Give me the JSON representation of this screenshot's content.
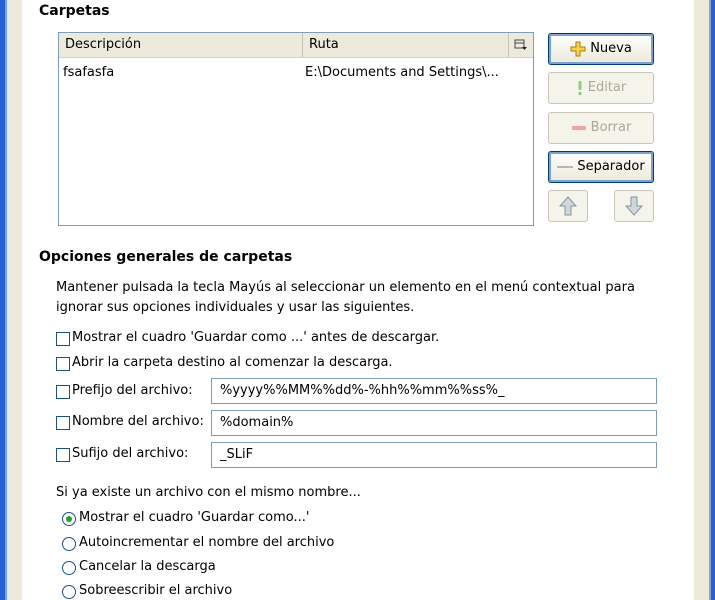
{
  "folders": {
    "title": "Carpetas",
    "columns": {
      "description": "Descripción",
      "path": "Ruta"
    },
    "rows": [
      {
        "description": "fsafasfa",
        "path": "E:\\Documents and Settings\\..."
      }
    ],
    "buttons": {
      "new": "Nueva",
      "edit": "Editar",
      "delete": "Borrar",
      "separator": "Separador"
    }
  },
  "general": {
    "title": "Opciones generales de carpetas",
    "description": "Mantener pulsada la tecla Mayús al seleccionar un elemento en el menú contextual para ignorar sus opciones individuales y usar las siguientes.",
    "show_save_as": "Mostrar el cuadro 'Guardar como ...' antes de descargar.",
    "open_folder": "Abrir la carpeta destino al comenzar la descarga.",
    "prefix_label": "Prefijo del archivo:",
    "prefix_value": "%yyyy%%MM%%dd%-%hh%%mm%%ss%_",
    "name_label": "Nombre del archivo:",
    "name_value": "%domain%",
    "suffix_label": "Sufijo del archivo:",
    "suffix_value": "_SLiF"
  },
  "exists": {
    "question": "Si ya existe un archivo con el mismo nombre...",
    "options": [
      "Mostrar el cuadro 'Guardar como...'",
      "Autoincrementar el nombre del archivo",
      "Cancelar la descarga",
      "Sobreescribir el archivo"
    ],
    "selected_index": 0
  },
  "colors": {
    "frame": "#2a5fd0",
    "dialog_bg": "#ece9d8",
    "radio_dot": "#21a121"
  }
}
